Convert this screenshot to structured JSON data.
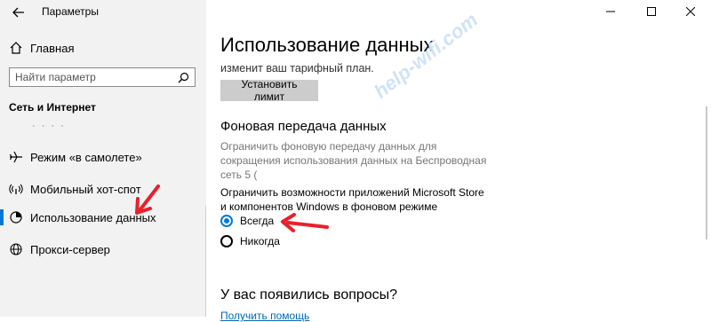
{
  "window": {
    "title": "Параметры",
    "controls": [
      "minimize",
      "maximize",
      "close"
    ]
  },
  "sidebar": {
    "home_label": "Главная",
    "search": {
      "placeholder": "Найти параметр"
    },
    "section_title": "Сеть и Интернет",
    "partial_label": "· · · ·",
    "items": [
      {
        "label": "Режим «в самолете»",
        "icon": "airplane-icon"
      },
      {
        "label": "Мобильный хот-спот",
        "icon": "hotspot-icon"
      },
      {
        "label": "Использование данных",
        "icon": "data-usage-icon",
        "selected": true
      },
      {
        "label": "Прокси-сервер",
        "icon": "globe-icon"
      }
    ]
  },
  "main": {
    "title": "Использование данных",
    "top_text": "изменит ваш тарифный план.",
    "set_limit_label": "Установить лимит",
    "background_heading": "Фоновая передача данных",
    "background_desc": "Ограничить фоновую передачу данных для сокращения использования данных на Беспроводная сеть 5 (",
    "store_desc": "Ограничить возможности приложений Microsoft Store и компонентов Windows в фоновом режиме",
    "radio_options": [
      {
        "label": "Всегда",
        "checked": true
      },
      {
        "label": "Никогда",
        "checked": false
      }
    ],
    "questions_heading": "У вас появились вопросы?",
    "help_link": "Получить помощь"
  },
  "watermark": "help-wifi.com",
  "colors": {
    "accent": "#0078d7",
    "sidebar_bg": "#f2f2f2",
    "button_bg": "#cccccc",
    "annotation": "#e8202a"
  }
}
